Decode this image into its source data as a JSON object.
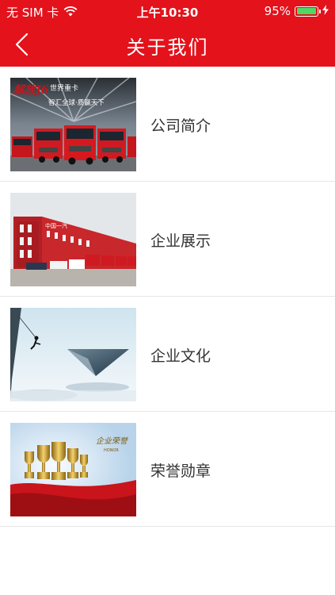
{
  "status_bar": {
    "carrier": "无 SIM 卡",
    "time": "上午10:30",
    "battery": "95%",
    "battery_level": 0.95
  },
  "nav": {
    "title": "关于我们",
    "back_icon": "chevron-left-icon"
  },
  "items": [
    {
      "label": "公司简介",
      "image": "trucks-photo",
      "image_text": {
        "logo": "解放J6",
        "line1": "世界重卡",
        "line2": "智汇全球·质赢天下"
      }
    },
    {
      "label": "企业展示",
      "image": "factory-building-photo",
      "image_text": {
        "sign": "中国一汽"
      }
    },
    {
      "label": "企业文化",
      "image": "climber-pyramid-photo"
    },
    {
      "label": "荣誉勋章",
      "image": "trophies-photo",
      "image_text": {
        "title": "企业荣誉",
        "sub": "HONOR"
      }
    }
  ],
  "colors": {
    "header": "#e3121b",
    "text": "#333333",
    "divider": "#e6e6e6",
    "battery_fill": "#4cd964"
  }
}
